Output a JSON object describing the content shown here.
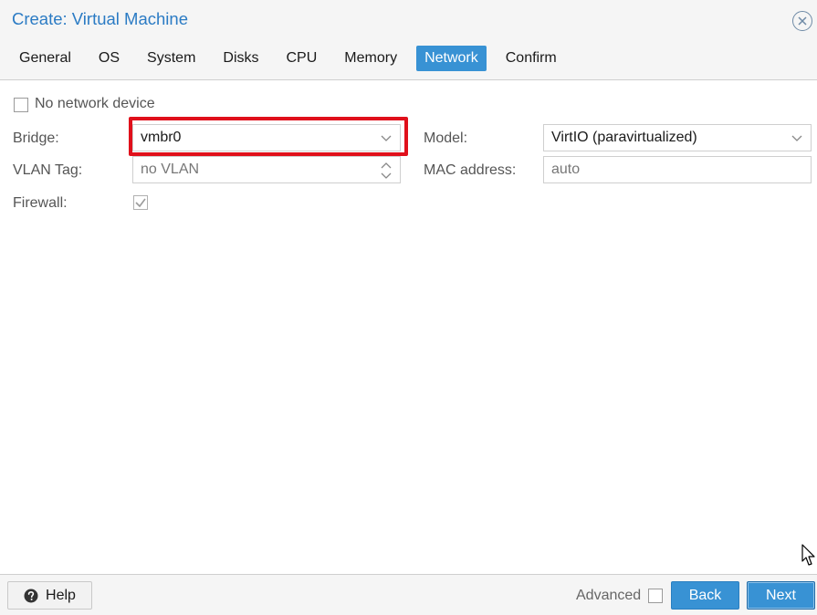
{
  "window": {
    "title": "Create: Virtual Machine"
  },
  "tabs": [
    {
      "label": "General"
    },
    {
      "label": "OS"
    },
    {
      "label": "System"
    },
    {
      "label": "Disks"
    },
    {
      "label": "CPU"
    },
    {
      "label": "Memory"
    },
    {
      "label": "Network",
      "active": true
    },
    {
      "label": "Confirm"
    }
  ],
  "form": {
    "no_network_device": {
      "label": "No network device",
      "checked": false
    },
    "bridge": {
      "label": "Bridge:",
      "value": "vmbr0"
    },
    "vlan_tag": {
      "label": "VLAN Tag:",
      "placeholder": "no VLAN"
    },
    "firewall": {
      "label": "Firewall:",
      "checked": true
    },
    "model": {
      "label": "Model:",
      "value": "VirtIO (paravirtualized)"
    },
    "mac_address": {
      "label": "MAC address:",
      "placeholder": "auto"
    }
  },
  "footer": {
    "help_label": "Help",
    "advanced_label": "Advanced",
    "advanced_checked": false,
    "back_label": "Back",
    "next_label": "Next"
  },
  "colors": {
    "accent": "#3892d4",
    "title": "#2b7bc4",
    "highlight": "#e0101b"
  },
  "icons": {
    "close": "close-circle-icon",
    "help": "question-circle-icon",
    "dropdown": "chevron-down-icon",
    "spinner": "spinner-updown-icon",
    "cursor": "mouse-pointer-icon"
  }
}
